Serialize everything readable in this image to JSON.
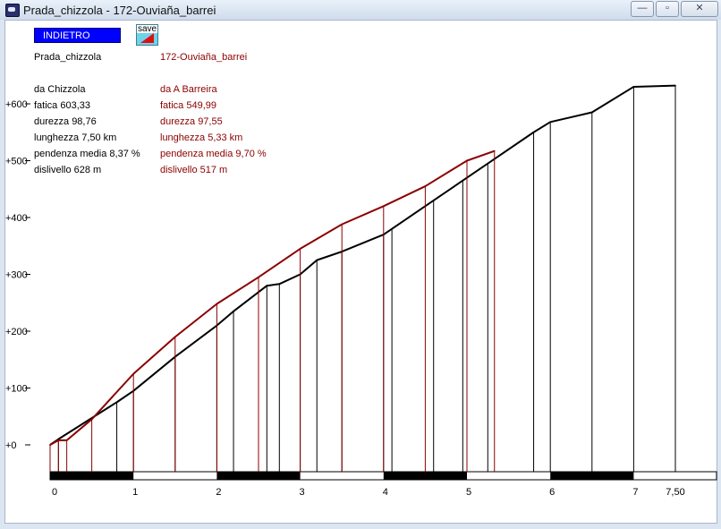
{
  "window": {
    "title": "Prada_chizzola - 172-Ouviaña_barrei",
    "minimize_glyph": "—",
    "maximize_glyph": "▫",
    "close_glyph": "✕"
  },
  "toolbar": {
    "back_label": "INDIETRO",
    "save_label": "save"
  },
  "routes": {
    "route1_name": "Prada_chizzola",
    "route2_name": "172-Ouviaña_barrei"
  },
  "stats": {
    "left": [
      "da Chizzola",
      "fatica 603,33",
      "durezza 98,76",
      "lunghezza 7,50 km",
      "pendenza media 8,37 %",
      "dislivello 628 m"
    ],
    "right": [
      "da A Barreira",
      "fatica 549,99",
      "durezza 97,55",
      "lunghezza 5,33 km",
      "pendenza media 9,70 %",
      "dislivello 517 m"
    ]
  },
  "colors": {
    "route1": "#000000",
    "route2": "#8b0000",
    "back_button": "#0000ff"
  },
  "chart_data": {
    "type": "line",
    "ylim": [
      0,
      630
    ],
    "xlim": [
      0,
      7.5
    ],
    "y_ticks": [
      {
        "label": "+0",
        "value": 0
      },
      {
        "label": "+100",
        "value": 100
      },
      {
        "label": "+200",
        "value": 200
      },
      {
        "label": "+300",
        "value": 300
      },
      {
        "label": "+400",
        "value": 400
      },
      {
        "label": "+500",
        "value": 500
      },
      {
        "label": "+600",
        "value": 600
      }
    ],
    "x_ticks": [
      {
        "label": "0",
        "value": 0
      },
      {
        "label": "1",
        "value": 1
      },
      {
        "label": "2",
        "value": 2
      },
      {
        "label": "3",
        "value": 3
      },
      {
        "label": "4",
        "value": 4
      },
      {
        "label": "5",
        "value": 5
      },
      {
        "label": "6",
        "value": 6
      },
      {
        "label": "7",
        "value": 7
      },
      {
        "label": "7,50",
        "value": 7.5
      }
    ],
    "series": [
      {
        "color": "#000000",
        "x": [
          0,
          0.1,
          0.8,
          1.0,
          1.5,
          2.0,
          2.2,
          2.6,
          2.75,
          3.0,
          3.2,
          3.5,
          4.0,
          4.1,
          4.6,
          4.95,
          5.25,
          5.8,
          6.0,
          6.5,
          7.0,
          7.5
        ],
        "y": [
          0,
          10,
          75,
          95,
          155,
          210,
          235,
          280,
          283,
          300,
          325,
          340,
          370,
          380,
          430,
          465,
          495,
          550,
          568,
          585,
          630,
          632
        ]
      },
      {
        "color": "#8b0000",
        "x": [
          0,
          0.1,
          0.2,
          0.5,
          1.0,
          1.5,
          2.0,
          2.5,
          3.0,
          3.5,
          4.0,
          4.5,
          5.0,
          5.33
        ],
        "y": [
          0,
          8,
          8,
          45,
          125,
          190,
          248,
          295,
          345,
          388,
          420,
          455,
          500,
          517
        ]
      }
    ]
  }
}
